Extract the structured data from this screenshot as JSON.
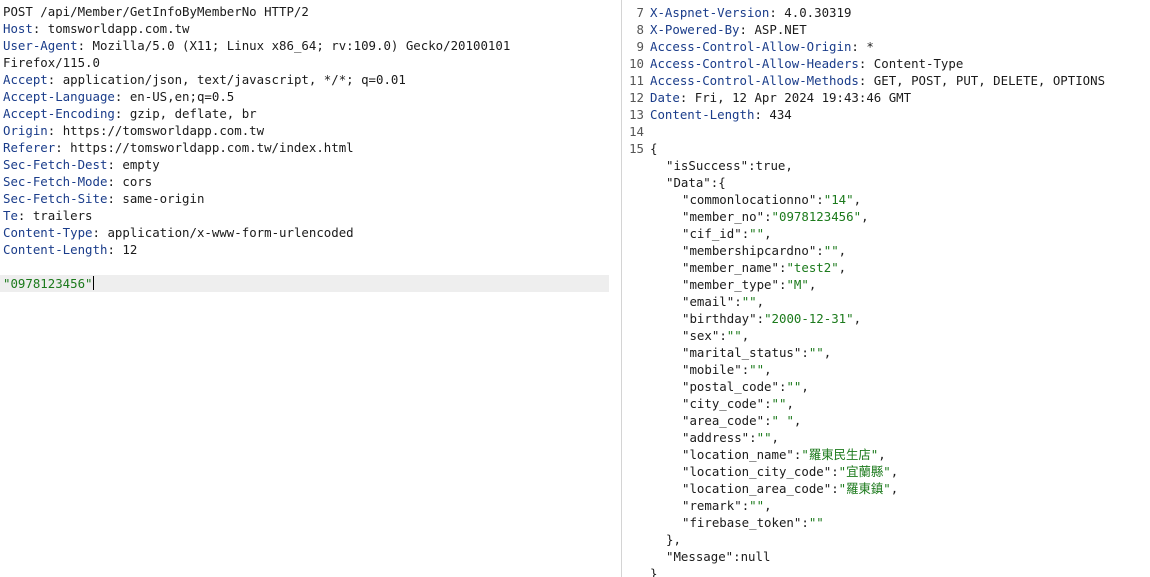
{
  "request": {
    "request_line": "POST /api/Member/GetInfoByMemberNo HTTP/2",
    "headers": [
      {
        "name": "Host",
        "value": "tomsworldapp.com.tw"
      },
      {
        "name": "User-Agent",
        "value": "Mozilla/5.0 (X11; Linux x86_64; rv:109.0) Gecko/20100101"
      },
      {
        "name": "",
        "value": "Firefox/115.0"
      },
      {
        "name": "Accept",
        "value": "application/json, text/javascript, */*; q=0.01"
      },
      {
        "name": "Accept-Language",
        "value": "en-US,en;q=0.5"
      },
      {
        "name": "Accept-Encoding",
        "value": "gzip, deflate, br"
      },
      {
        "name": "Origin",
        "value": "https://tomsworldapp.com.tw"
      },
      {
        "name": "Referer",
        "value": "https://tomsworldapp.com.tw/index.html"
      },
      {
        "name": "Sec-Fetch-Dest",
        "value": "empty"
      },
      {
        "name": "Sec-Fetch-Mode",
        "value": "cors"
      },
      {
        "name": "Sec-Fetch-Site",
        "value": "same-origin"
      },
      {
        "name": "Te",
        "value": "trailers"
      },
      {
        "name": "Content-Type",
        "value": "application/x-www-form-urlencoded"
      },
      {
        "name": "Content-Length",
        "value": "12"
      }
    ],
    "body": "\"0978123456\""
  },
  "response": {
    "headers": [
      {
        "num": "7",
        "name": "X-Aspnet-Version",
        "value": "4.0.30319"
      },
      {
        "num": "8",
        "name": "X-Powered-By",
        "value": "ASP.NET"
      },
      {
        "num": "9",
        "name": "Access-Control-Allow-Origin",
        "value": "*"
      },
      {
        "num": "10",
        "name": "Access-Control-Allow-Headers",
        "value": "Content-Type"
      },
      {
        "num": "11",
        "name": "Access-Control-Allow-Methods",
        "value": "GET, POST, PUT, DELETE, OPTIONS"
      },
      {
        "num": "12",
        "name": "Date",
        "value": "Fri, 12 Apr 2024 19:43:46 GMT"
      },
      {
        "num": "13",
        "name": "Content-Length",
        "value": "434"
      }
    ],
    "blank_line_num": "14",
    "body_line_num": "15",
    "json_open": "{",
    "is_success_key": "\"isSuccess\"",
    "is_success_value": "true",
    "data_key": "\"Data\"",
    "data_open": ":{",
    "fields": [
      {
        "key": "\"commonlocationno\"",
        "value": "\"14\"",
        "comma": ","
      },
      {
        "key": "\"member_no\"",
        "value": "\"0978123456\"",
        "comma": ","
      },
      {
        "key": "\"cif_id\"",
        "value": "\"\"",
        "comma": ","
      },
      {
        "key": "\"membershipcardno\"",
        "value": "\"\"",
        "comma": ","
      },
      {
        "key": "\"member_name\"",
        "value": "\"test2\"",
        "comma": ","
      },
      {
        "key": "\"member_type\"",
        "value": "\"M\"",
        "comma": ","
      },
      {
        "key": "\"email\"",
        "value": "\"\"",
        "comma": ","
      },
      {
        "key": "\"birthday\"",
        "value": "\"2000-12-31\"",
        "comma": ","
      },
      {
        "key": "\"sex\"",
        "value": "\"\"",
        "comma": ","
      },
      {
        "key": "\"marital_status\"",
        "value": "\"\"",
        "comma": ","
      },
      {
        "key": "\"mobile\"",
        "value": "\"\"",
        "comma": ","
      },
      {
        "key": "\"postal_code\"",
        "value": "\"\"",
        "comma": ","
      },
      {
        "key": "\"city_code\"",
        "value": "\"\"",
        "comma": ","
      },
      {
        "key": "\"area_code\"",
        "value": "\" \"",
        "comma": ","
      },
      {
        "key": "\"address\"",
        "value": "\"\"",
        "comma": ","
      },
      {
        "key": "\"location_name\"",
        "value": "\"羅東民生店\"",
        "comma": ","
      },
      {
        "key": "\"location_city_code\"",
        "value": "\"宜蘭縣\"",
        "comma": ","
      },
      {
        "key": "\"location_area_code\"",
        "value": "\"羅東鎮\"",
        "comma": ","
      },
      {
        "key": "\"remark\"",
        "value": "\"\"",
        "comma": ","
      },
      {
        "key": "\"firebase_token\"",
        "value": "\"\"",
        "comma": ""
      }
    ],
    "data_close": "},",
    "message_key": "\"Message\"",
    "message_value": ":null",
    "json_close": "}"
  }
}
